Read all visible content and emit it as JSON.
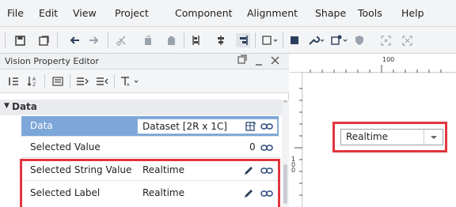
{
  "menu": [
    "File",
    "Edit",
    "View",
    "Project",
    "Component",
    "Alignment",
    "Shape",
    "Tools",
    "Help"
  ],
  "toolbar_icons": [
    "save-icon",
    "save-all-icon",
    "back-icon",
    "forward-icon",
    "cut-icon",
    "copy-icon",
    "paste-icon",
    "align-left-icon",
    "align-center-icon",
    "align-right-icon",
    "rectangle-icon",
    "fill-icon",
    "wrench-icon",
    "script-icon",
    "shield-icon",
    "grid-icon",
    "dashed-grid-icon"
  ],
  "panel": {
    "title": "Vision Property Editor",
    "section": "Data",
    "rows": [
      {
        "name": "Data",
        "value": "Dataset [2R x 1C]",
        "selected": true
      },
      {
        "name": "Selected Value",
        "value": "0"
      },
      {
        "name": "Selected String Value",
        "value": "Realtime"
      },
      {
        "name": "Selected Label",
        "value": "Realtime"
      }
    ]
  },
  "designer": {
    "ruler_label": "100",
    "ruler_v_label": "100",
    "dropdown_value": "Realtime"
  },
  "colors": {
    "highlight": "#e0363f",
    "selected_row": "#7da7d9",
    "link_icon": "#2c4a7a"
  }
}
